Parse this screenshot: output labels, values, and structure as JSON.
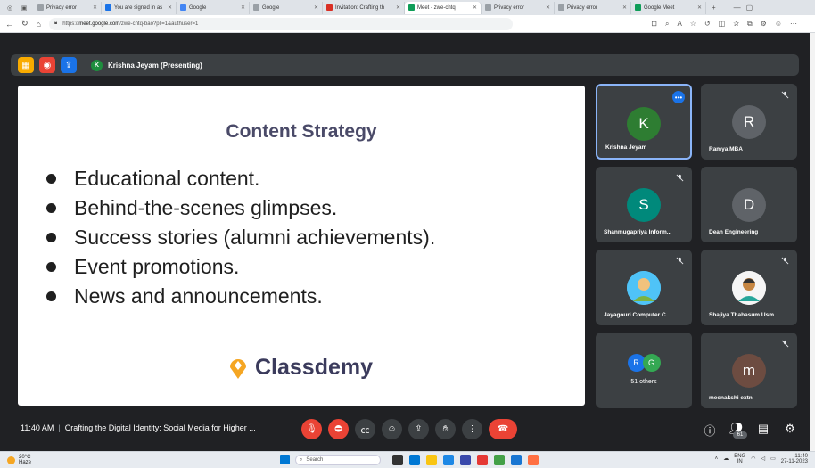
{
  "browser": {
    "tabs": [
      {
        "title": "Privacy error",
        "color": "#9aa0a6"
      },
      {
        "title": "You are signed in as",
        "color": "#1a73e8"
      },
      {
        "title": "Google",
        "color": "#4285f4"
      },
      {
        "title": "Google",
        "color": "#9aa0a6"
      },
      {
        "title": "Invitation: Crafting th",
        "color": "#d93025"
      },
      {
        "title": "Meet - zwe-chtq",
        "color": "#0f9d58",
        "active": true
      },
      {
        "title": "Privacy error",
        "color": "#9aa0a6"
      },
      {
        "title": "Privacy error",
        "color": "#9aa0a6"
      },
      {
        "title": "Google Meet",
        "color": "#0f9d58"
      }
    ],
    "url_prefix": "https://",
    "url_domain": "meet.google.com",
    "url_path": "/zwe-chtq-bao?pli=1&authuser=1"
  },
  "meet": {
    "presenter_initial": "K",
    "presenter_label": "Krishna Jeyam (Presenting)",
    "slide": {
      "title": "Content Strategy",
      "bullets": [
        "Educational content.",
        "Behind-the-scenes glimpses.",
        "Success stories (alumni achievements).",
        "Event promotions.",
        "News and announcements."
      ],
      "brand": "Classdemy"
    },
    "participants": [
      {
        "name": "Krishna Jeyam",
        "initial": "K",
        "color": "#2e7d32",
        "active": true
      },
      {
        "name": "Ramya MBA",
        "initial": "R",
        "color": "#5f6368"
      },
      {
        "name": "Shanmugapriya Inform...",
        "initial": "S",
        "color": "#00897b"
      },
      {
        "name": "Dean Engineering",
        "initial": "D",
        "color": "#5f6368"
      },
      {
        "name": "Jayagouri Computer C...",
        "initial": "",
        "color": "#4fc3f7"
      },
      {
        "name": "Shajiya Thabasum Usm...",
        "initial": "",
        "color": "#e0e0e0"
      },
      {
        "name": "meenakshi extn",
        "initial": "m",
        "color": "#6d4c41"
      }
    ],
    "others": {
      "initials": [
        "R",
        "G"
      ],
      "label": "51 others"
    },
    "time": "11:40 AM",
    "meeting_title": "Crafting the Digital Identity: Social Media for Higher ...",
    "people_count": "61"
  },
  "taskbar": {
    "temp": "20°C",
    "weather": "Haze",
    "search_placeholder": "Search",
    "lang": "ENG",
    "region": "IN",
    "clock_time": "11:40",
    "clock_date": "27-11-2023"
  }
}
